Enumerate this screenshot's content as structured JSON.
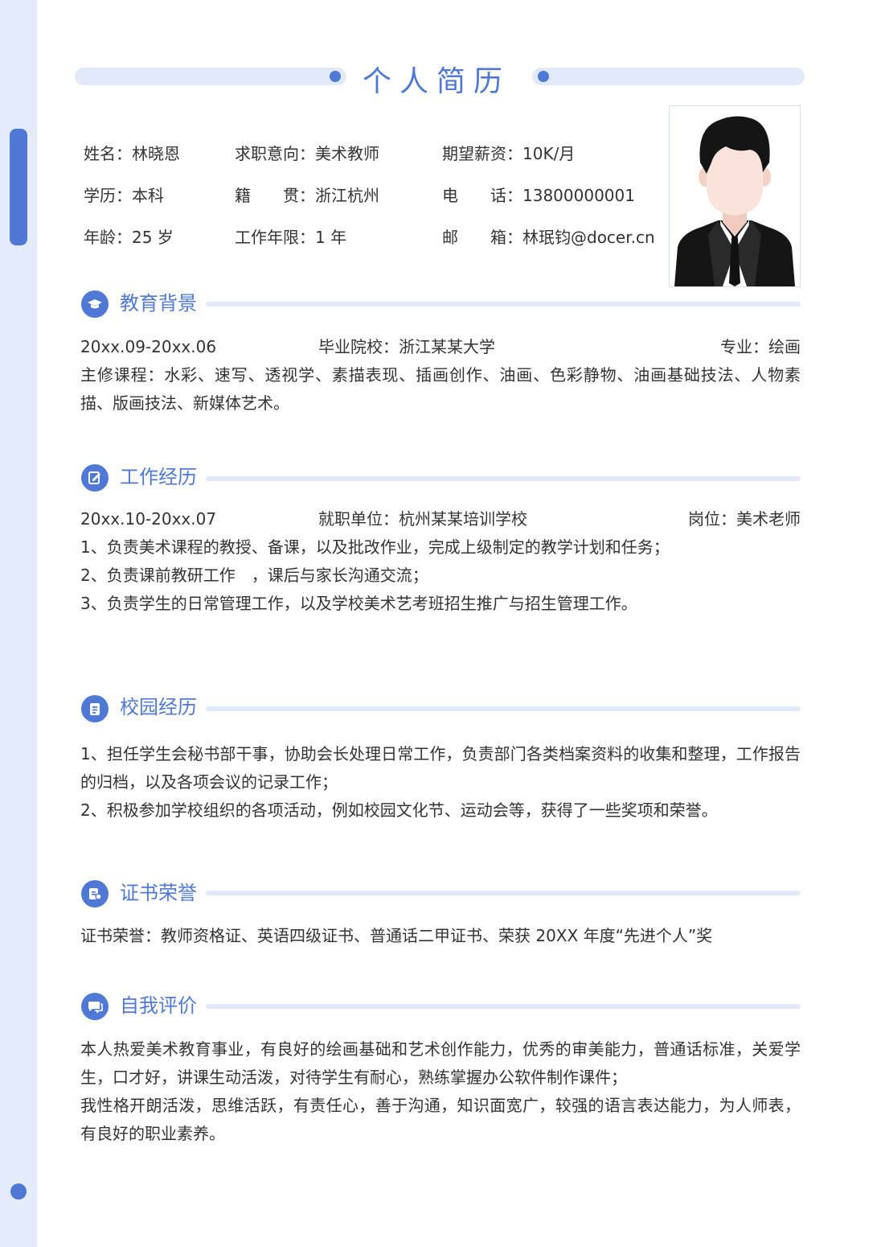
{
  "title": "个人简历",
  "basic_info": [
    {
      "label": "姓名：",
      "value": "林晓恩"
    },
    {
      "label": "求职意向：",
      "value": "美术教师"
    },
    {
      "label": "期望薪资：",
      "value": "10K/月"
    },
    {
      "label": "学历：",
      "value": "本科"
    },
    {
      "label": "籍　　贯：",
      "value": "浙江杭州"
    },
    {
      "label": "电　　话：",
      "value": "13800000001"
    },
    {
      "label": "年龄：",
      "value": "25 岁"
    },
    {
      "label": "工作年限：",
      "value": "1 年"
    },
    {
      "label": "邮　　箱：",
      "value": "林珉钧@docer.cn"
    }
  ],
  "education": {
    "heading": "教育背景",
    "period": "20xx.09-20xx.06",
    "school": "毕业院校：浙江某某大学",
    "major": "专业：绘画",
    "courses": "主修课程：水彩、速写、透视学、素描表现、插画创作、油画、色彩静物、油画基础技法、人物素描、版画技法、新媒体艺术。"
  },
  "work": {
    "heading": "工作经历",
    "period": "20xx.10-20xx.07",
    "company": "就职单位：杭州某某培训学校",
    "position": "岗位：美术老师",
    "duties": [
      "1、负责美术课程的教授、备课，以及批改作业，完成上级制定的教学计划和任务；",
      "2、负责课前教研工作　，课后与家长沟通交流；",
      "3、负责学生的日常管理工作，以及学校美术艺考班招生推广与招生管理工作。"
    ]
  },
  "campus": {
    "heading": "校园经历",
    "items": [
      "1、担任学生会秘书部干事，协助会长处理日常工作，负责部门各类档案资料的收集和整理，工作报告的归档，以及各项会议的记录工作；",
      "2、积极参加学校组织的各项活动，例如校园文化节、运动会等，获得了一些奖项和荣誉。"
    ]
  },
  "certificates": {
    "heading": "证书荣誉",
    "text": "证书荣誉：教师资格证、英语四级证书、普通话二甲证书、荣获 20XX 年度“先进个人”奖"
  },
  "self_evaluation": {
    "heading": "自我评价",
    "paragraphs": [
      "本人热爱美术教育事业，有良好的绘画基础和艺术创作能力，优秀的审美能力，普通话标准，关爱学生，口才好，讲课生动活泼，对待学生有耐心，熟练掌握办公软件制作课件；",
      "我性格开朗活泼，思维活跃，有责任心，善于沟通，知识面宽广，较强的语言表达能力，为人师表，有良好的职业素养。"
    ]
  },
  "colors": {
    "accent": "#4f79d5",
    "light_band": "#e2e9f8",
    "sidebar": "#e4ebfa",
    "text": "#333333"
  },
  "icons": {
    "education": "graduation-cap-icon",
    "work": "edit-note-icon",
    "campus": "document-icon",
    "certificates": "certificate-icon",
    "self_evaluation": "chat-bubble-icon"
  }
}
